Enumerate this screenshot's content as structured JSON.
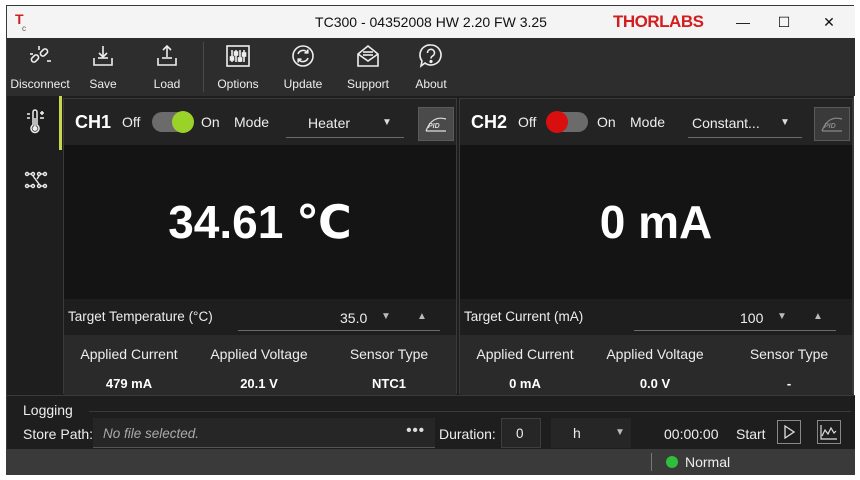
{
  "window": {
    "title": "TC300 - 04352008 HW 2.20 FW 3.25",
    "brand": "THORLABS",
    "minimize_glyph": "—",
    "maximize_glyph": "☐",
    "close_glyph": "✕"
  },
  "toolbar": {
    "disconnect": "Disconnect",
    "save": "Save",
    "load": "Load",
    "options": "Options",
    "update": "Update",
    "support": "Support",
    "about": "About"
  },
  "sidebar": {
    "items": [
      {
        "icon": "thermometer-icon",
        "active": true
      },
      {
        "icon": "connections-icon",
        "active": false
      }
    ]
  },
  "ch1": {
    "label": "CH1",
    "off": "Off",
    "on": "On",
    "mode_label": "Mode",
    "mode_value": "Heater",
    "toggle_state": "on",
    "toggle_color": "#9bd22a",
    "display": "34.61 ℃",
    "target_label": "Target Temperature (°C)",
    "target_value": "35.0",
    "stats_headers": [
      "Applied Current",
      "Applied Voltage",
      "Sensor Type"
    ],
    "stats_values": [
      "479 mA",
      "20.1 V",
      "NTC1"
    ]
  },
  "ch2": {
    "label": "CH2",
    "off": "Off",
    "on": "On",
    "mode_label": "Mode",
    "mode_value": "Constant...",
    "toggle_state": "off",
    "toggle_color": "#d90f0f",
    "display": "0 mA",
    "target_label": "Target Current (mA)",
    "target_value": "100",
    "stats_headers": [
      "Applied Current",
      "Applied Voltage",
      "Sensor Type"
    ],
    "stats_values": [
      "0 mA",
      "0.0 V",
      "-"
    ]
  },
  "logging": {
    "title": "Logging",
    "store_label": "Store Path:",
    "store_placeholder": "No file selected.",
    "browse": "•••",
    "duration_label": "Duration:",
    "duration_value": "0",
    "unit": "h",
    "timer": "00:00:00",
    "start": "Start"
  },
  "status": {
    "text": "Normal",
    "color": "#2fbf3a"
  },
  "colors": {
    "accent": "#c7d84a",
    "brand_red": "#d21e1e"
  }
}
